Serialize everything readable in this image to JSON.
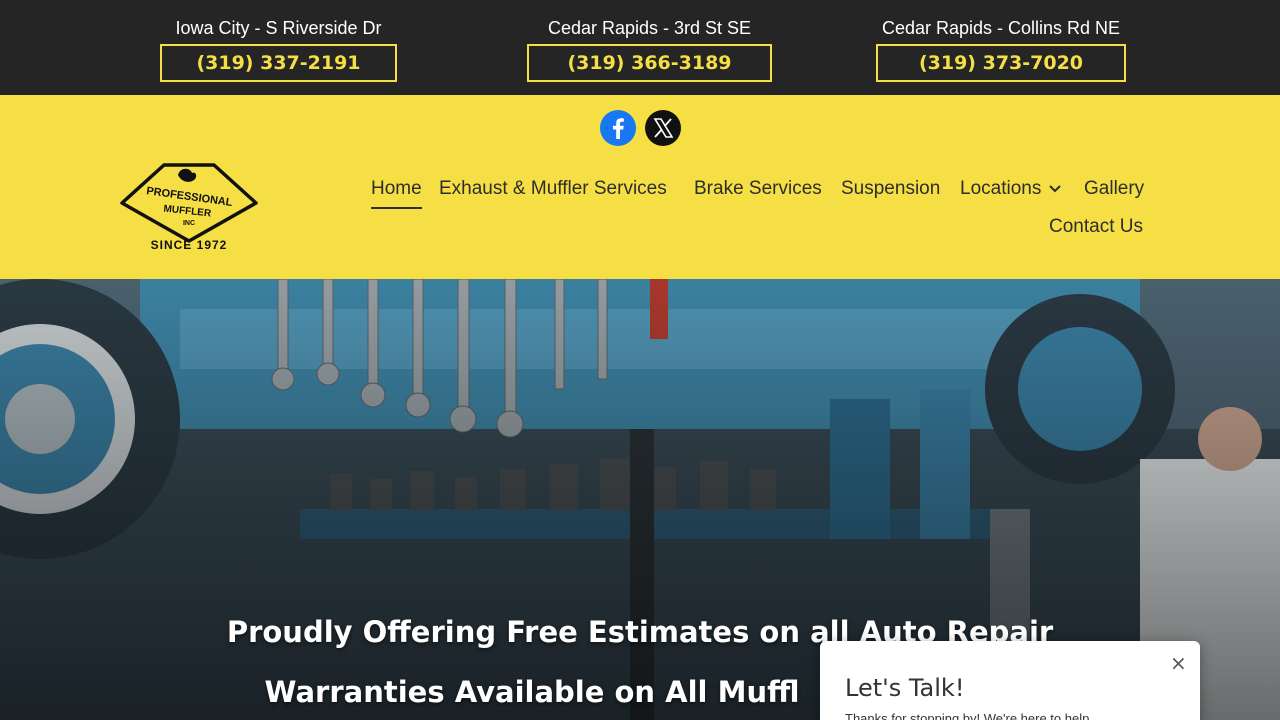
{
  "locations": [
    {
      "name": "Iowa City - S Riverside Dr",
      "phone": "(319) 337-2191"
    },
    {
      "name": "Cedar Rapids - 3rd St SE",
      "phone": "(319) 366-3189"
    },
    {
      "name": "Cedar Rapids - Collins Rd NE",
      "phone": "(319) 373-7020"
    }
  ],
  "social": {
    "facebook_icon": "facebook-icon",
    "x_icon": "x-icon"
  },
  "logo": {
    "line1": "PROFESSIONAL",
    "line2": "MUFFLER",
    "line3": "INC",
    "line4": "SINCE 1972"
  },
  "nav": {
    "items": [
      "Home",
      "Exhaust & Muffler Services",
      "Brake Services",
      "Suspension",
      "Locations",
      "Gallery",
      "Contact Us"
    ],
    "active": "Home"
  },
  "hero": {
    "line1": "Proudly Offering Free Estimates on all Auto Repair",
    "line2": "Warranties Available on All Muffl"
  },
  "chat": {
    "title": "Let's Talk!",
    "close": "×",
    "body": "Thanks for stopping by! We're here to help..."
  },
  "colors": {
    "accent": "#f6df45",
    "topbar": "#252525",
    "facebook": "#1877f2"
  }
}
